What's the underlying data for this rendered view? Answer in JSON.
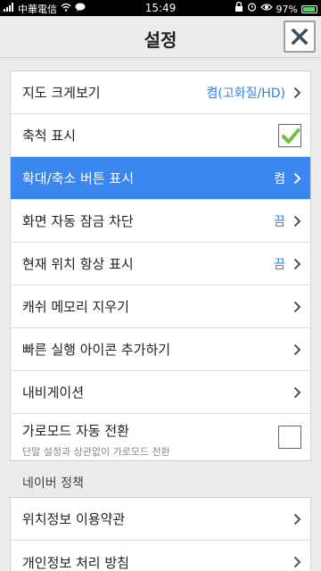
{
  "status_bar": {
    "carrier": "中華電信",
    "time": "15:49",
    "battery": "97%"
  },
  "header": {
    "title": "설정",
    "close_label": "×"
  },
  "settings_group": {
    "items": [
      {
        "label": "지도 크게보기",
        "value": "켬(고화질/HD)",
        "type": "nav"
      },
      {
        "label": "축척 표시",
        "type": "checkbox",
        "checked": true
      },
      {
        "label": "확대/축소 버튼 표시",
        "value": "켬",
        "type": "nav",
        "active": true
      },
      {
        "label": "화면 자동 잠금 차단",
        "value": "끔",
        "type": "nav"
      },
      {
        "label": "현재 위치 항상 표시",
        "value": "끔",
        "type": "nav"
      },
      {
        "label": "캐쉬 메모리 지우기",
        "type": "nav"
      },
      {
        "label": "빠른 실행 아이콘 추가하기",
        "type": "nav"
      },
      {
        "label": "내비게이션",
        "type": "nav"
      },
      {
        "label": "가로모드 자동 전환",
        "sublabel": "단말 설정과 상관없이 가로모드 전환",
        "type": "checkbox",
        "checked": false
      }
    ]
  },
  "policy_section": {
    "title": "네이버 정책",
    "items": [
      {
        "label": "위치정보 이용약관"
      },
      {
        "label": "개인정보 처리 방침"
      }
    ]
  },
  "colors": {
    "accent": "#3a86f0",
    "value_text": "#2f82e6",
    "check_green": "#6cc33c"
  }
}
